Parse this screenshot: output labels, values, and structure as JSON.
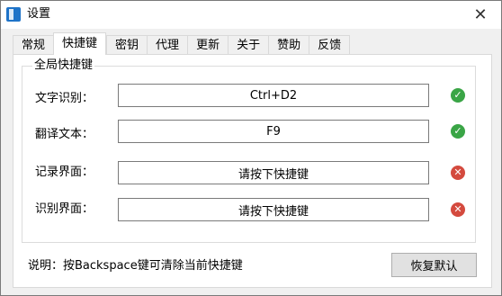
{
  "window": {
    "title": "设置",
    "close_glyph": "✕"
  },
  "tabs": [
    {
      "label": "常规"
    },
    {
      "label": "快捷键",
      "active": true
    },
    {
      "label": "密钥"
    },
    {
      "label": "代理"
    },
    {
      "label": "更新"
    },
    {
      "label": "关于"
    },
    {
      "label": "赞助"
    },
    {
      "label": "反馈"
    }
  ],
  "hotkeys": {
    "group_title": "全局快捷键",
    "rows": [
      {
        "label": "文字识别：",
        "value": "Ctrl+D2",
        "status": "ok",
        "status_glyph": "✓"
      },
      {
        "label": "翻译文本：",
        "value": "F9",
        "status": "ok",
        "status_glyph": "✓"
      },
      {
        "label": "记录界面：",
        "value": "请按下快捷键",
        "status": "error",
        "status_glyph": "✕"
      },
      {
        "label": "识别界面：",
        "value": "请按下快捷键",
        "status": "error",
        "status_glyph": "✕"
      }
    ]
  },
  "footer": {
    "hint": "说明：按Backspace键可清除当前快捷键",
    "reset_label": "恢复默认"
  },
  "colors": {
    "ok": "#3aa546",
    "error": "#d44a3e"
  }
}
